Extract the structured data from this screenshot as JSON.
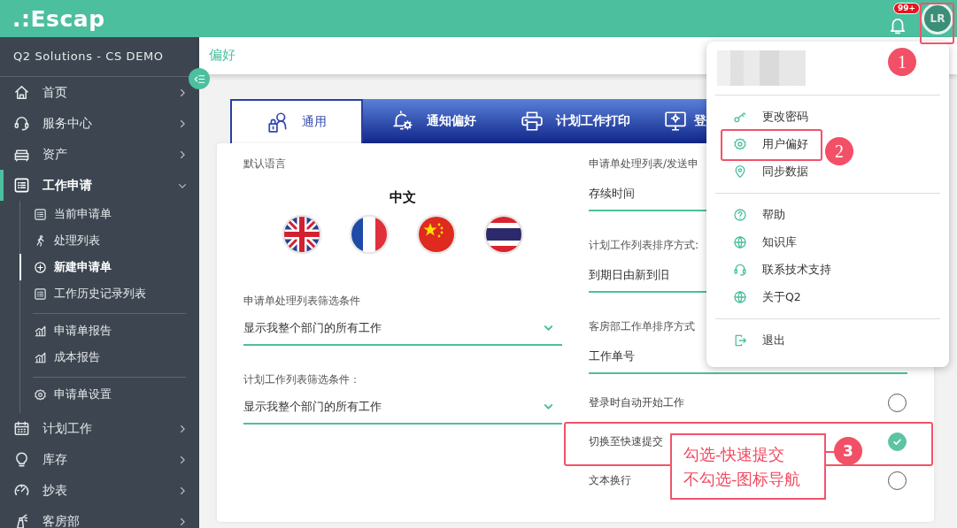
{
  "topbar": {
    "logo": ".:Escap",
    "notification_badge": "99+",
    "avatar_initials": "LR"
  },
  "sidebar": {
    "org": "Q2 Solutions - CS DEMO",
    "items": [
      {
        "label": "首页",
        "expanded": false,
        "selected": false
      },
      {
        "label": "服务中心",
        "expanded": false,
        "selected": false
      },
      {
        "label": "资产",
        "expanded": false,
        "selected": false
      },
      {
        "label": "工作申请",
        "expanded": true,
        "selected": true,
        "children": [
          {
            "label": "当前申请单",
            "selected": false,
            "divider_before": false
          },
          {
            "label": "处理列表",
            "selected": false,
            "divider_before": false
          },
          {
            "label": "新建申请单",
            "selected": true,
            "divider_before": false
          },
          {
            "label": "工作历史记录列表",
            "selected": false,
            "divider_before": false
          },
          {
            "label": "申请单报告",
            "selected": false,
            "divider_before": true
          },
          {
            "label": "成本报告",
            "selected": false,
            "divider_before": false
          },
          {
            "label": "申请单设置",
            "selected": false,
            "divider_before": true
          }
        ]
      },
      {
        "label": "计划工作",
        "expanded": false,
        "selected": false
      },
      {
        "label": "库存",
        "expanded": false,
        "selected": false
      },
      {
        "label": "抄表",
        "expanded": false,
        "selected": false
      },
      {
        "label": "客房部",
        "expanded": false,
        "selected": false
      }
    ]
  },
  "page": {
    "title": "偏好",
    "tabs": [
      {
        "label": "通用",
        "selected": true
      },
      {
        "label": "通知偏好",
        "selected": false
      },
      {
        "label": "计划工作打印",
        "selected": false
      },
      {
        "label": "登",
        "selected": false
      }
    ],
    "left": [
      {
        "kind": "language",
        "label": "默认语言",
        "value": "中文"
      },
      {
        "kind": "select",
        "label": "申请单处理列表筛选条件",
        "value": "显示我整个部门的所有工作"
      },
      {
        "kind": "select",
        "label": "计划工作列表筛选条件：",
        "value": "显示我整个部门的所有工作"
      }
    ],
    "right": [
      {
        "kind": "select",
        "label": "申请单处理列表/发送申",
        "value": "存续时间"
      },
      {
        "kind": "select",
        "label": "计划工作列表排序方式:",
        "value": "到期日由新到旧"
      },
      {
        "kind": "select",
        "label": "客房部工作单排序方式",
        "value": "工作单号"
      },
      {
        "kind": "toggle",
        "label": "登录时自动开始工作",
        "checked": false
      },
      {
        "kind": "toggle",
        "label": "切换至快速提交",
        "checked": true
      },
      {
        "kind": "toggle",
        "label": "文本换行",
        "checked": false
      }
    ]
  },
  "user_menu": {
    "groups": [
      [
        {
          "label": "更改密码"
        },
        {
          "label": "用户偏好"
        },
        {
          "label": "同步数据"
        }
      ],
      [
        {
          "label": "帮助"
        },
        {
          "label": "知识库"
        },
        {
          "label": "联系技术支持"
        },
        {
          "label": "关于Q2"
        }
      ],
      [
        {
          "label": "退出"
        }
      ]
    ]
  },
  "annotations": [
    {
      "number": "1"
    },
    {
      "number": "2"
    },
    {
      "number": "3",
      "note": [
        "勾选-快速提交",
        "不勾选-图标导航"
      ]
    }
  ]
}
